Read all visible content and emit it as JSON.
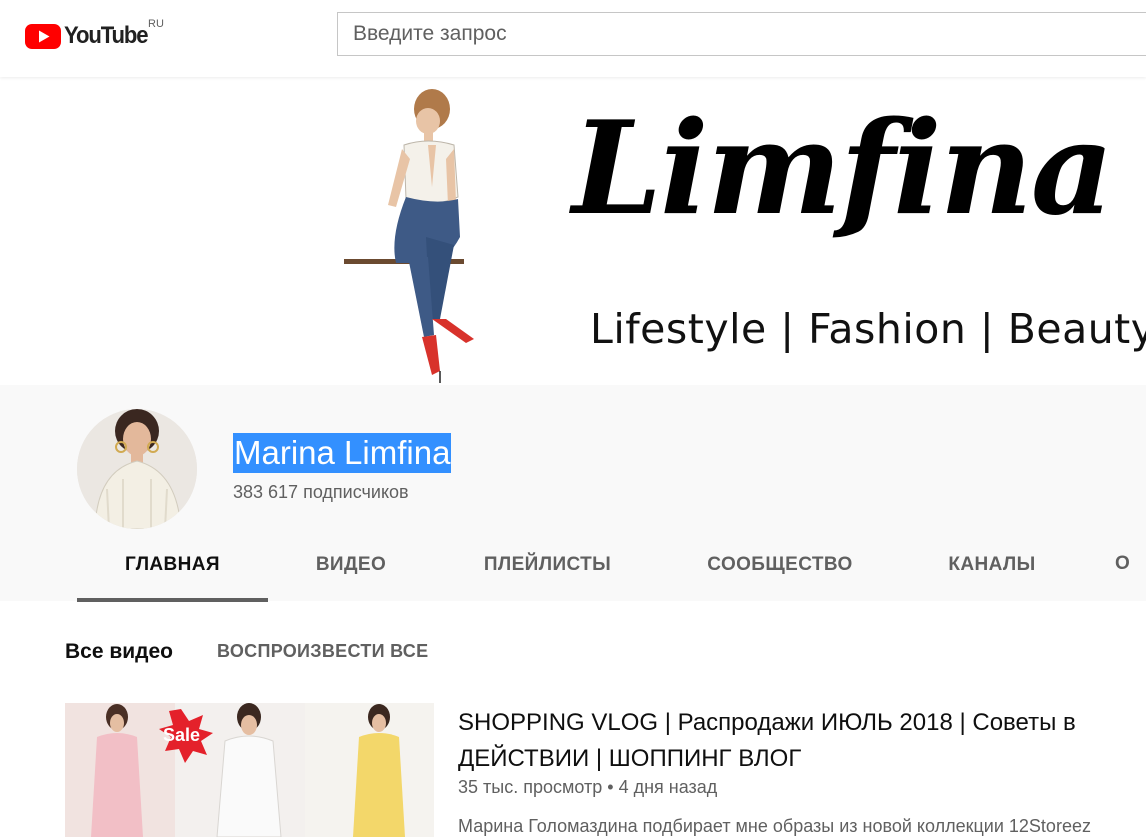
{
  "header": {
    "logo_text": "YouTube",
    "region": "RU",
    "search_placeholder": "Введите запрос"
  },
  "banner": {
    "title": "Limfina",
    "tagline": "Lifestyle | Fashion | Beauty"
  },
  "channel": {
    "name": "Marina Limfina",
    "subscribers": "383 617 подписчиков",
    "name_highlight_color": "#3390ff"
  },
  "tabs": [
    {
      "label": "ГЛАВНАЯ",
      "active": true
    },
    {
      "label": "ВИДЕО",
      "active": false
    },
    {
      "label": "ПЛЕЙЛИСТЫ",
      "active": false
    },
    {
      "label": "СООБЩЕСТВО",
      "active": false
    },
    {
      "label": "КАНАЛЫ",
      "active": false
    },
    {
      "label": "О",
      "active": false
    }
  ],
  "shelf": {
    "title": "Все видео",
    "play_all": "ВОСПРОИЗВЕСТИ ВСЕ"
  },
  "video": {
    "thumbnail_badge": "Sale",
    "title": "SHOPPING VLOG | Распродажи ИЮЛЬ 2018 | Советы в ДЕЙСТВИИ | ШОППИНГ ВЛОГ",
    "views": "35 тыс. просмотр",
    "age": "4 дня назад",
    "description": "Марина Голомаздина подбирает мне образы из новой коллекции 12Storeez"
  },
  "colors": {
    "brand_red": "#ff0000",
    "secondary_text": "#606060",
    "header_bg": "#f9f9f9"
  }
}
